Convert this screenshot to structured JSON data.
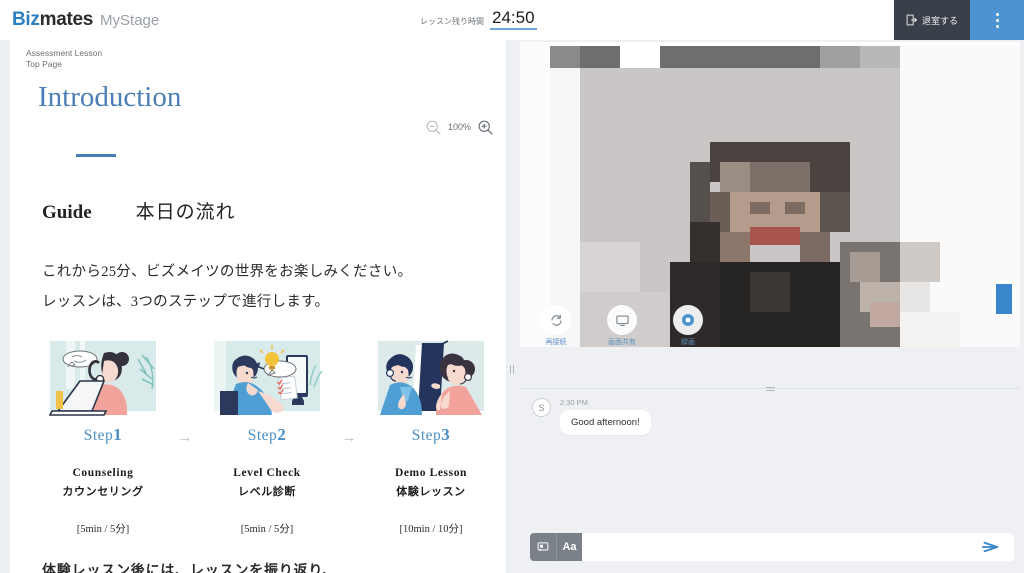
{
  "header": {
    "logo_primary": "Biz",
    "logo_secondary": "mates",
    "logo_product": "MyStage",
    "timer_label": "レッスン残り時間",
    "timer_value": "24:50",
    "leave_label": "退室する",
    "exit_icon": "exit-door-icon",
    "kebab_icon": "more-vertical-icon",
    "colors": {
      "accent_blue": "#4b93d1",
      "dark": "#3a4049",
      "logo_blue": "#2a7fc1"
    }
  },
  "material": {
    "breadcrumb": {
      "line1": "Assessment Lesson",
      "line2": "Top Page"
    },
    "title": "Introduction",
    "zoom": {
      "out_icon": "zoom-out-icon",
      "level": "100%",
      "in_icon": "zoom-in-icon"
    },
    "guide": {
      "en": "Guide",
      "jp": "本日の流れ"
    },
    "intro_lines": [
      "これから25分、ビズメイツの世界をお楽しみください。",
      "レッスンは、3つのステップで進行します。"
    ],
    "arrow": "→",
    "steps": [
      {
        "label_prefix": "Step",
        "number": "1",
        "title_en": "Counseling",
        "title_jp": "カウンセリング",
        "duration": "[5min / 5分]",
        "illustration": "woman-with-headset-at-laptop-illustration"
      },
      {
        "label_prefix": "Step",
        "number": "2",
        "title_en": "Level Check",
        "title_jp": "レベル診断",
        "duration": "[5min / 5分]",
        "illustration": "man-at-monitor-with-lightbulb-illustration"
      },
      {
        "label_prefix": "Step",
        "number": "3",
        "title_en": "Demo Lesson",
        "title_jp": "体験レッスン",
        "duration": "[10min / 10分]",
        "illustration": "two-people-presentation-illustration"
      }
    ],
    "closing_line": "体験レッスン後には、レッスンを振り返り、"
  },
  "video": {
    "controls": [
      {
        "label": "再接続",
        "icon": "reconnect-icon"
      },
      {
        "label": "画面共有",
        "icon": "screen-share-icon"
      },
      {
        "label": "録画",
        "icon": "record-icon"
      }
    ]
  },
  "chat": {
    "messages": [
      {
        "avatar": "S",
        "time": "2:30 PM",
        "text": "Good afternoon!"
      }
    ],
    "input": {
      "placeholder": "",
      "value": "",
      "sticker_icon": "sticker-icon",
      "format_label": "Aa",
      "send_icon": "send-icon"
    }
  }
}
